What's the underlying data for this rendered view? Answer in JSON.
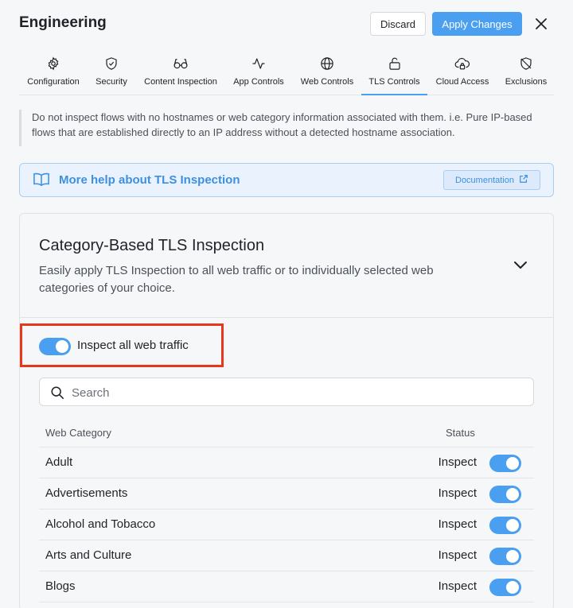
{
  "header": {
    "title": "Engineering",
    "discard_label": "Discard",
    "apply_label": "Apply Changes"
  },
  "tabs": [
    {
      "label": "Configuration",
      "icon": "gear-icon"
    },
    {
      "label": "Security",
      "icon": "shield-check-icon"
    },
    {
      "label": "Content Inspection",
      "icon": "glasses-icon"
    },
    {
      "label": "App Controls",
      "icon": "activity-icon"
    },
    {
      "label": "Web Controls",
      "icon": "globe-icon"
    },
    {
      "label": "TLS Controls",
      "icon": "unlock-icon",
      "active": true
    },
    {
      "label": "Cloud Access",
      "icon": "cloud-lock-icon"
    },
    {
      "label": "Exclusions",
      "icon": "shield-off-icon"
    }
  ],
  "note": "Do not inspect flows with no hostnames or web category information associated with them. i.e. Pure IP-based flows that are established directly to an IP address without a detected hostname association.",
  "help": {
    "text": "More help about TLS Inspection",
    "doc_label": "Documentation"
  },
  "section": {
    "title": "Category-Based TLS Inspection",
    "description": "Easily apply TLS Inspection to all web traffic or to individually selected web categories of your choice.",
    "inspect_all_label": "Inspect all web traffic",
    "inspect_all_on": true
  },
  "search": {
    "placeholder": "Search"
  },
  "table": {
    "col_category": "Web Category",
    "col_status": "Status",
    "rows": [
      {
        "name": "Adult",
        "status": "Inspect",
        "on": true
      },
      {
        "name": "Advertisements",
        "status": "Inspect",
        "on": true
      },
      {
        "name": "Alcohol and Tobacco",
        "status": "Inspect",
        "on": true
      },
      {
        "name": "Arts and Culture",
        "status": "Inspect",
        "on": true
      },
      {
        "name": "Blogs",
        "status": "Inspect",
        "on": true
      }
    ]
  },
  "colors": {
    "accent": "#4a9ff0",
    "highlight": "#e8371d"
  }
}
